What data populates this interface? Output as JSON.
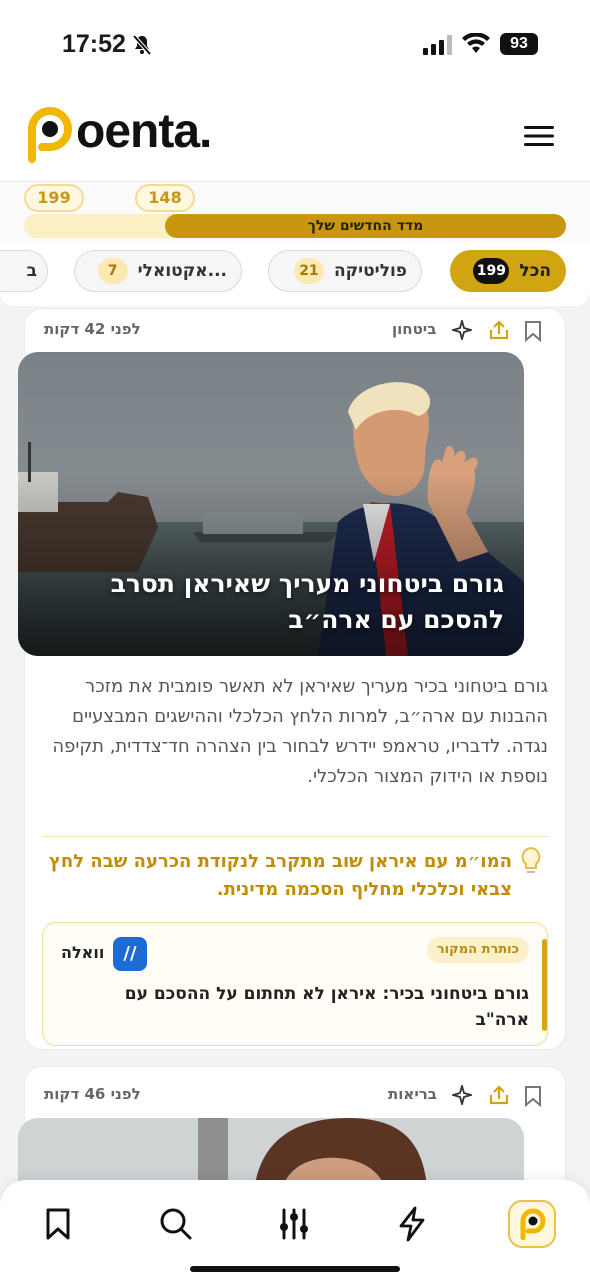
{
  "status_bar": {
    "time": "17:52",
    "battery": "93"
  },
  "brand": {
    "logo_text": "oenta.",
    "accent_color": "#d1a412"
  },
  "meter": {
    "left_value": "199",
    "right_value": "148",
    "label": "מדד החדשים שלך"
  },
  "tabs": [
    {
      "label": "הכל",
      "count": "199",
      "active": true
    },
    {
      "label": "פוליטיקה",
      "count": "21",
      "active": false
    },
    {
      "label": "אקטואלי...",
      "count": "7",
      "active": false
    },
    {
      "label": "ב",
      "count": "",
      "active": false
    }
  ],
  "article1": {
    "time_ago": "לפני 42 דקות",
    "category": "ביטחון",
    "image_title": "גורם ביטחוני מעריך שאיראן תסרב להסכם עם ארה״ב",
    "summary": "גורם ביטחוני בכיר מעריך שאיראן לא תאשר פומבית את מזכר ההבנות עם ארה״ב, למרות הלחץ הכלכלי וההישגים המבצעיים נגדה. לדבריו, טראמפ יידרש לבחור בין הצהרה חד־צדדית, תקיפה נוספת או הידוק המצור הכלכלי.",
    "insight": "המו״מ עם איראן שוב מתקרב לנקודת הכרעה שבה לחץ צבאי וכלכלי מחליף הסכמה מדינית.",
    "source": {
      "tag": "כותרת המקור",
      "name": "וואלה",
      "title": "גורם ביטחוני בכיר: איראן לא תחתום על ההסכם עם ארה\"ב"
    }
  },
  "article2": {
    "time_ago": "לפני 46 דקות",
    "category": "בריאות"
  },
  "icons": [
    "bell-off-icon",
    "signal-icon",
    "wifi-icon",
    "menu-icon",
    "bookmark-icon",
    "share-icon",
    "sparkle-icon",
    "bulb-icon",
    "search-icon",
    "sliders-icon",
    "bolt-icon",
    "poenta-logo-icon"
  ]
}
